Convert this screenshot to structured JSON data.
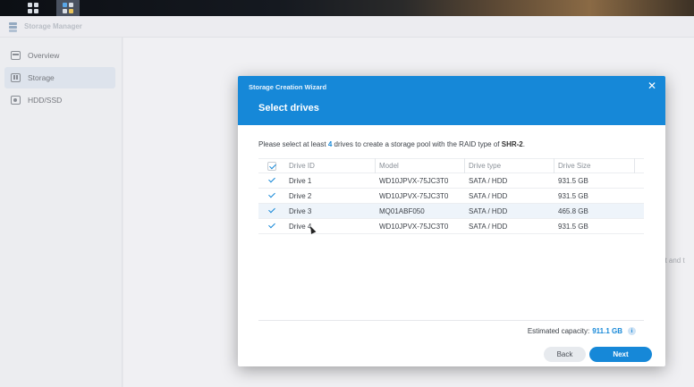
{
  "taskbar": {
    "buttons": [
      {
        "icon": "main-menu-grid-icon"
      },
      {
        "icon": "storage-manager-app-icon"
      }
    ]
  },
  "app": {
    "title": "Storage Manager",
    "icon": "storage-manager-icon"
  },
  "sidebar": {
    "items": [
      {
        "label": "Overview",
        "icon": "overview-icon",
        "active": false
      },
      {
        "label": "Storage",
        "icon": "storage-icon",
        "active": true
      },
      {
        "label": "HDD/SSD",
        "icon": "hdd-icon",
        "active": false
      }
    ]
  },
  "background": {
    "partial_text": "irst and t"
  },
  "wizard": {
    "title": "Storage Creation Wizard",
    "step_title": "Select drives",
    "instruction": {
      "prefix": "Please select at least",
      "count": "4",
      "middle": "drives to create a storage pool with the RAID type of",
      "raid": "SHR-2",
      "suffix": "."
    },
    "table": {
      "headers": {
        "id": "Drive ID",
        "model": "Model",
        "type": "Drive type",
        "size": "Drive Size"
      },
      "rows": [
        {
          "id": "Drive 1",
          "model": "WD10JPVX-75JC3T0",
          "type": "SATA / HDD",
          "size": "931.5 GB",
          "checked": true
        },
        {
          "id": "Drive 2",
          "model": "WD10JPVX-75JC3T0",
          "type": "SATA / HDD",
          "size": "931.5 GB",
          "checked": true
        },
        {
          "id": "Drive 3",
          "model": "MQ01ABF050",
          "type": "SATA / HDD",
          "size": "465.8 GB",
          "checked": true
        },
        {
          "id": "Drive 4",
          "model": "WD10JPVX-75JC3T0",
          "type": "SATA / HDD",
          "size": "931.5 GB",
          "checked": true
        }
      ]
    },
    "estimated": {
      "label": "Estimated capacity:",
      "value": "911.1 GB"
    },
    "buttons": {
      "back": "Back",
      "next": "Next"
    }
  },
  "colors": {
    "accent": "#1688d8",
    "header_bg": "#1688d8",
    "selected_sidebar": "#dde7f1"
  }
}
